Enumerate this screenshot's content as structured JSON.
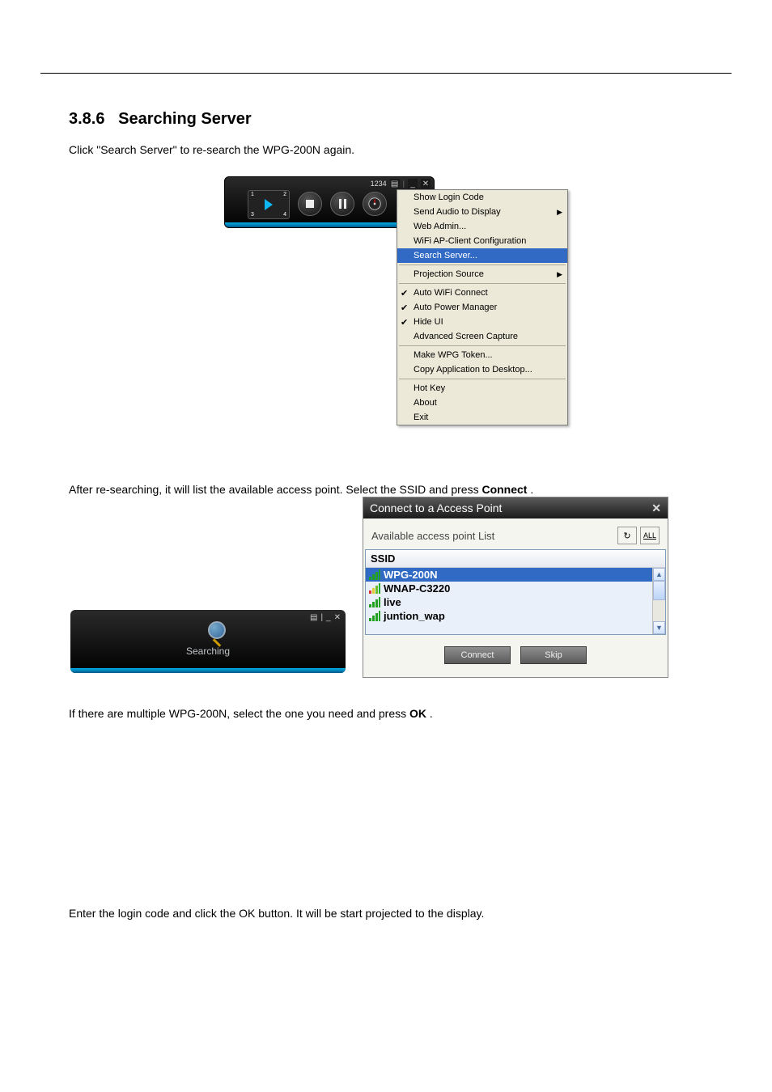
{
  "doc": {
    "section_number": "3.8.6",
    "section_title": "Searching Server",
    "line1": "Click \"Search Server\" to re-search the WPG-200N again.",
    "line2_pre": "After re-searching, it will list the available access point. Select the SSID and press ",
    "line2_bold": "Connect",
    "line2_post": ".",
    "line3_pre": "If there are multiple WPG-200N, select the one you need and press ",
    "line3_bold": "OK",
    "line3_post": ".",
    "line4": "Enter the login code and click the OK button. It will be start projected to the display."
  },
  "control_bar": {
    "digits": "1234"
  },
  "menu": {
    "items": [
      {
        "label": "Show Login Code",
        "check": false,
        "arrow": false
      },
      {
        "label": "Send Audio to Display",
        "check": false,
        "arrow": true
      },
      {
        "label": "Web Admin...",
        "check": false,
        "arrow": false
      },
      {
        "label": "WiFi AP-Client Configuration",
        "check": false,
        "arrow": false
      },
      {
        "label": "Search Server...",
        "check": false,
        "arrow": false,
        "highlight": true
      }
    ],
    "items2": [
      {
        "label": "Projection Source",
        "check": false,
        "arrow": true
      }
    ],
    "items3": [
      {
        "label": "Auto WiFi Connect",
        "check": true
      },
      {
        "label": "Auto Power Manager",
        "check": true
      },
      {
        "label": "Hide UI",
        "check": true
      },
      {
        "label": "Advanced Screen Capture",
        "check": false
      }
    ],
    "items4": [
      {
        "label": "Make WPG Token...",
        "check": false
      },
      {
        "label": "Copy Application to Desktop...",
        "check": false
      }
    ],
    "items5": [
      {
        "label": "Hot Key"
      },
      {
        "label": "About"
      },
      {
        "label": "Exit"
      }
    ]
  },
  "searching": {
    "label": "Searching"
  },
  "ap_dialog": {
    "title": "Connect to a Access Point",
    "list_label": "Available access point List",
    "refresh_icon": "↻",
    "all_label": "ALL",
    "header": "SSID",
    "rows": [
      {
        "ssid": "WPG-200N",
        "selected": true
      },
      {
        "ssid": "WNAP-C3220",
        "selected": false,
        "strong": true
      },
      {
        "ssid": "live",
        "selected": false
      },
      {
        "ssid": "juntion_wap",
        "selected": false
      }
    ],
    "connect_btn": "Connect",
    "skip_btn": "Skip"
  }
}
